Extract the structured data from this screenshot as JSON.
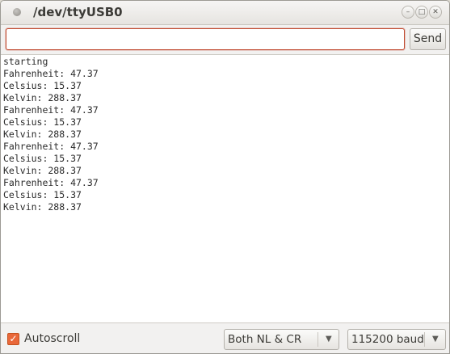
{
  "window": {
    "title": "/dev/ttyUSB0",
    "minimize_glyph": "–",
    "maximize_glyph": "□",
    "close_glyph": "✕"
  },
  "toolbar": {
    "input_value": "",
    "send_label": "Send"
  },
  "serial_output": [
    "starting",
    "Fahrenheit: 47.37",
    "Celsius: 15.37",
    "Kelvin: 288.37",
    "Fahrenheit: 47.37",
    "Celsius: 15.37",
    "Kelvin: 288.37",
    "Fahrenheit: 47.37",
    "Celsius: 15.37",
    "Kelvin: 288.37",
    "Fahrenheit: 47.37",
    "Celsius: 15.37",
    "Kelvin: 288.37"
  ],
  "footer": {
    "autoscroll_label": "Autoscroll",
    "autoscroll_checked": true,
    "check_glyph": "✓",
    "line_ending": "Both NL & CR",
    "baud_rate": "115200 baud",
    "dropdown_glyph": "▼"
  },
  "colors": {
    "accent": "#e9683a",
    "focus_border": "#c0492f",
    "background": "#f2f1f0"
  },
  "icons": {
    "window_menu": "circle-icon",
    "minimize": "minimize-icon",
    "maximize": "maximize-icon",
    "close": "close-icon",
    "checkbox": "checkmark-icon",
    "dropdown": "chevron-down-icon"
  }
}
